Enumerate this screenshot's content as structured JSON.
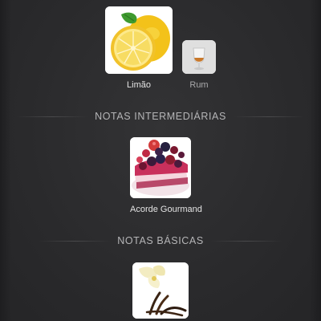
{
  "top_notes": [
    {
      "label": "Limão",
      "image": "lemon-icon"
    },
    {
      "label": "Rum",
      "image": "rum-glass-icon"
    }
  ],
  "sections": {
    "middle_title": "NOTAS INTERMEDIÁRIAS",
    "base_title": "NOTAS BÁSICAS"
  },
  "middle_notes": [
    {
      "label": "Acorde Gourmand",
      "image": "berry-cheesecake-icon"
    }
  ],
  "base_notes": [
    {
      "label": "",
      "image": "vanilla-flower-icon"
    }
  ]
}
